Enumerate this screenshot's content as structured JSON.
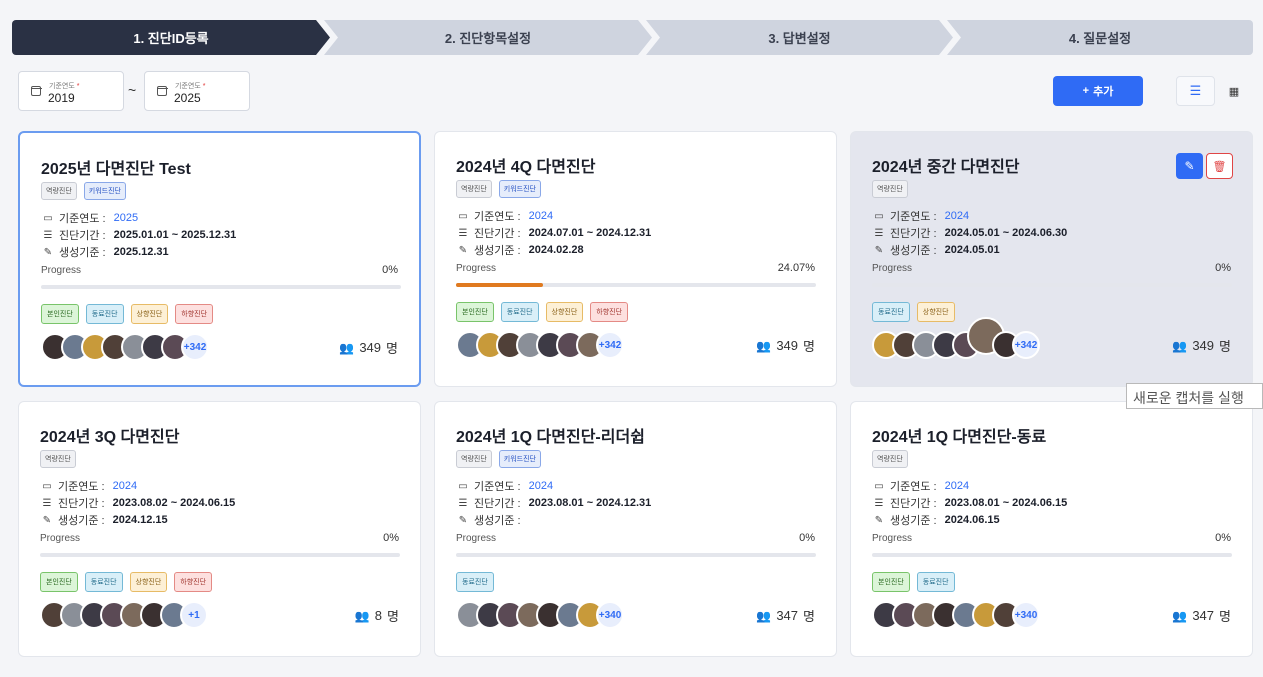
{
  "steps": [
    {
      "label": "1. 진단ID등록",
      "active": true
    },
    {
      "label": "2. 진단항목설정",
      "active": false
    },
    {
      "label": "3. 답변설정",
      "active": false
    },
    {
      "label": "4. 질문설정",
      "active": false
    }
  ],
  "filters": {
    "from": {
      "label": "기준연도",
      "required": "*",
      "value": "2019"
    },
    "separator": "~",
    "to": {
      "label": "기준연도",
      "required": "*",
      "value": "2025"
    }
  },
  "toolbar": {
    "add_icon": "+",
    "add_label": "추가",
    "list_icon": "list-icon",
    "grid_icon": "grid-icon"
  },
  "labels": {
    "year": "기준연도 :",
    "period": "진단기간 :",
    "created": "생성기준 :",
    "progress": "Progress",
    "unit": "명"
  },
  "colors": {
    "accent": "#2f6bf5",
    "stepActive": "#2a3144",
    "progressFill": "#e07a1f"
  },
  "cards": [
    {
      "title": "2025년 다면진단 Test",
      "tags": [
        {
          "text": "역량진단",
          "style": "gray"
        },
        {
          "text": "키워드진단",
          "style": "blue"
        }
      ],
      "year": "2025",
      "period": "2025.01.01 ~ 2025.12.31",
      "created": "2025.12.31",
      "progress_text": "0%",
      "progress": 0,
      "ptags": [
        {
          "text": "본인진단",
          "c": "g"
        },
        {
          "text": "동료진단",
          "c": "c"
        },
        {
          "text": "상향진단",
          "c": "o"
        },
        {
          "text": "하향진단",
          "c": "r"
        }
      ],
      "more": "+342",
      "count": "349"
    },
    {
      "title": "2024년 4Q 다면진단",
      "tags": [
        {
          "text": "역량진단",
          "style": "gray"
        },
        {
          "text": "키워드진단",
          "style": "blue"
        }
      ],
      "year": "2024",
      "period": "2024.07.01 ~ 2024.12.31",
      "created": "2024.02.28",
      "progress_text": "24.07%",
      "progress": 0.2407,
      "ptags": [
        {
          "text": "본인진단",
          "c": "g"
        },
        {
          "text": "동료진단",
          "c": "c"
        },
        {
          "text": "상향진단",
          "c": "o"
        },
        {
          "text": "하향진단",
          "c": "r"
        }
      ],
      "more": "+342",
      "count": "349"
    },
    {
      "title": "2024년 중간 다면진단",
      "tags": [
        {
          "text": "역량진단",
          "style": "gray"
        }
      ],
      "year": "2024",
      "period": "2024.05.01 ~ 2024.06.30",
      "created": "2024.05.01",
      "progress_text": "0%",
      "progress": 0,
      "ptags": [
        {
          "text": "동료진단",
          "c": "c"
        },
        {
          "text": "상향진단",
          "c": "o"
        }
      ],
      "more": "+342",
      "count": "349",
      "hover": true
    },
    {
      "title": "2024년 3Q 다면진단",
      "tags": [
        {
          "text": "역량진단",
          "style": "gray"
        }
      ],
      "year": "2024",
      "period": "2023.08.02 ~ 2024.06.15",
      "created": "2024.12.15",
      "progress_text": "0%",
      "progress": 0,
      "ptags": [
        {
          "text": "본인진단",
          "c": "g"
        },
        {
          "text": "동료진단",
          "c": "c"
        },
        {
          "text": "상향진단",
          "c": "o"
        },
        {
          "text": "하향진단",
          "c": "r"
        }
      ],
      "more": "+1",
      "count": "8"
    },
    {
      "title": "2024년 1Q 다면진단-리더쉽",
      "tags": [
        {
          "text": "역량진단",
          "style": "gray"
        },
        {
          "text": "키워드진단",
          "style": "blue"
        }
      ],
      "year": "2024",
      "period": "2023.08.01 ~ 2024.12.31",
      "created": "",
      "progress_text": "0%",
      "progress": 0,
      "ptags": [
        {
          "text": "동료진단",
          "c": "c"
        }
      ],
      "more": "+340",
      "count": "347"
    },
    {
      "title": "2024년 1Q 다면진단-동료",
      "tags": [
        {
          "text": "역량진단",
          "style": "gray"
        }
      ],
      "year": "2024",
      "period": "2023.08.01 ~ 2024.06.15",
      "created": "2024.06.15",
      "progress_text": "0%",
      "progress": 0,
      "ptags": [
        {
          "text": "본인진단",
          "c": "g"
        },
        {
          "text": "동료진단",
          "c": "c"
        }
      ],
      "more": "+340",
      "count": "347"
    }
  ],
  "tooltip": "새로운 캡처를 실행"
}
